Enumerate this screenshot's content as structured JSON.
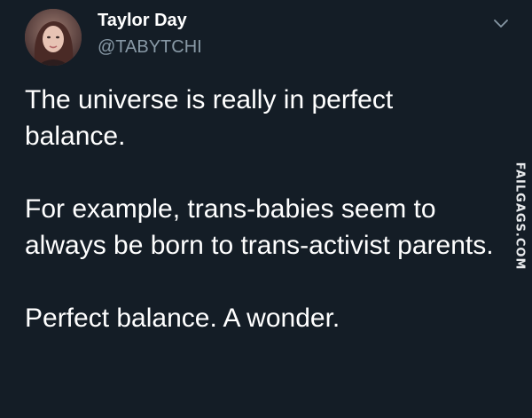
{
  "colors": {
    "background": "#141d26",
    "text_primary": "#ffffff",
    "text_secondary": "#8899a6"
  },
  "author": {
    "display_name": "Taylor Day",
    "handle": "@TABYTCHI",
    "avatar_icon": "avatar-photo"
  },
  "menu": {
    "icon": "chevron-down-icon"
  },
  "tweet": {
    "paragraphs": [
      "The universe is really in perfect balance.",
      "For example, trans-babies seem to always be born to trans-activist parents.",
      "Perfect balance. A wonder."
    ]
  },
  "watermark": {
    "text": "FAILGAGS.COM"
  }
}
